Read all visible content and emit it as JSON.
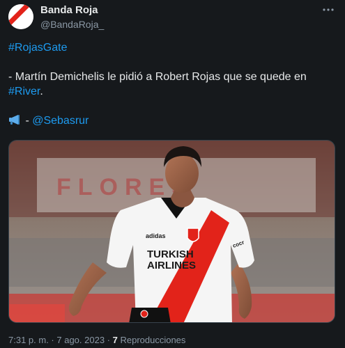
{
  "author": {
    "display_name": "Banda Roja",
    "handle": "@BandaRoja_",
    "avatar_icon": "river-plate-sash-icon"
  },
  "more_icon": "more-options-icon",
  "tweet": {
    "hashtag": "#RojasGate",
    "line2_prefix": "- Martín Demichelis le pidió a Robert Rojas que se quede en",
    "line2_link": "#River",
    "line2_suffix": ".",
    "credit_icon": "megaphone-icon",
    "credit_prefix": " - ",
    "credit_link": "@Sebasrur"
  },
  "media": {
    "description_icon": "photo-icon",
    "jersey_brand": "adidas",
    "jersey_sponsor_line1": "TURKISH",
    "jersey_sponsor_line2": "AIRLINES",
    "jersey_sleeve": "cocr",
    "banner_text": "FLORES"
  },
  "footer": {
    "time": "7:31 p. m.",
    "separator1": " · ",
    "date": "7 ago. 2023",
    "separator2": " · ",
    "views_count": "7",
    "views_label": " Reproducciones"
  },
  "colors": {
    "background": "#16191c",
    "text": "#e7e9ea",
    "muted": "#8b98a5",
    "link": "#1d9bf0",
    "river_red": "#e2231a"
  }
}
